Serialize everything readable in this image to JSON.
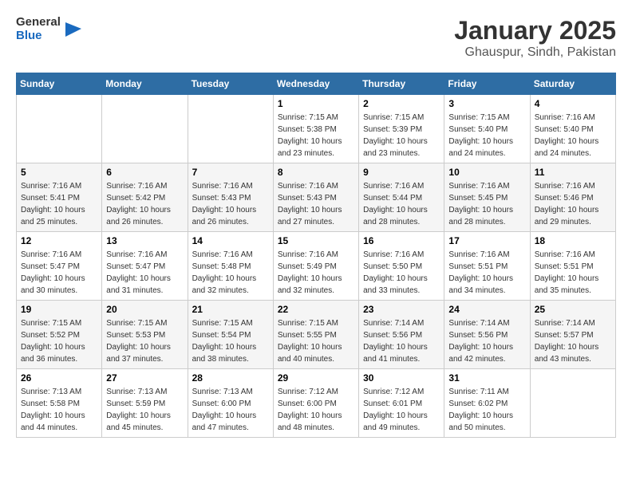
{
  "header": {
    "logo_general": "General",
    "logo_blue": "Blue",
    "month": "January 2025",
    "location": "Ghauspur, Sindh, Pakistan"
  },
  "weekdays": [
    "Sunday",
    "Monday",
    "Tuesday",
    "Wednesday",
    "Thursday",
    "Friday",
    "Saturday"
  ],
  "weeks": [
    [
      {
        "day": "",
        "sunrise": "",
        "sunset": "",
        "daylight": ""
      },
      {
        "day": "",
        "sunrise": "",
        "sunset": "",
        "daylight": ""
      },
      {
        "day": "",
        "sunrise": "",
        "sunset": "",
        "daylight": ""
      },
      {
        "day": "1",
        "sunrise": "7:15 AM",
        "sunset": "5:38 PM",
        "daylight": "10 hours and 23 minutes."
      },
      {
        "day": "2",
        "sunrise": "7:15 AM",
        "sunset": "5:39 PM",
        "daylight": "10 hours and 23 minutes."
      },
      {
        "day": "3",
        "sunrise": "7:15 AM",
        "sunset": "5:40 PM",
        "daylight": "10 hours and 24 minutes."
      },
      {
        "day": "4",
        "sunrise": "7:16 AM",
        "sunset": "5:40 PM",
        "daylight": "10 hours and 24 minutes."
      }
    ],
    [
      {
        "day": "5",
        "sunrise": "7:16 AM",
        "sunset": "5:41 PM",
        "daylight": "10 hours and 25 minutes."
      },
      {
        "day": "6",
        "sunrise": "7:16 AM",
        "sunset": "5:42 PM",
        "daylight": "10 hours and 26 minutes."
      },
      {
        "day": "7",
        "sunrise": "7:16 AM",
        "sunset": "5:43 PM",
        "daylight": "10 hours and 26 minutes."
      },
      {
        "day": "8",
        "sunrise": "7:16 AM",
        "sunset": "5:43 PM",
        "daylight": "10 hours and 27 minutes."
      },
      {
        "day": "9",
        "sunrise": "7:16 AM",
        "sunset": "5:44 PM",
        "daylight": "10 hours and 28 minutes."
      },
      {
        "day": "10",
        "sunrise": "7:16 AM",
        "sunset": "5:45 PM",
        "daylight": "10 hours and 28 minutes."
      },
      {
        "day": "11",
        "sunrise": "7:16 AM",
        "sunset": "5:46 PM",
        "daylight": "10 hours and 29 minutes."
      }
    ],
    [
      {
        "day": "12",
        "sunrise": "7:16 AM",
        "sunset": "5:47 PM",
        "daylight": "10 hours and 30 minutes."
      },
      {
        "day": "13",
        "sunrise": "7:16 AM",
        "sunset": "5:47 PM",
        "daylight": "10 hours and 31 minutes."
      },
      {
        "day": "14",
        "sunrise": "7:16 AM",
        "sunset": "5:48 PM",
        "daylight": "10 hours and 32 minutes."
      },
      {
        "day": "15",
        "sunrise": "7:16 AM",
        "sunset": "5:49 PM",
        "daylight": "10 hours and 32 minutes."
      },
      {
        "day": "16",
        "sunrise": "7:16 AM",
        "sunset": "5:50 PM",
        "daylight": "10 hours and 33 minutes."
      },
      {
        "day": "17",
        "sunrise": "7:16 AM",
        "sunset": "5:51 PM",
        "daylight": "10 hours and 34 minutes."
      },
      {
        "day": "18",
        "sunrise": "7:16 AM",
        "sunset": "5:51 PM",
        "daylight": "10 hours and 35 minutes."
      }
    ],
    [
      {
        "day": "19",
        "sunrise": "7:15 AM",
        "sunset": "5:52 PM",
        "daylight": "10 hours and 36 minutes."
      },
      {
        "day": "20",
        "sunrise": "7:15 AM",
        "sunset": "5:53 PM",
        "daylight": "10 hours and 37 minutes."
      },
      {
        "day": "21",
        "sunrise": "7:15 AM",
        "sunset": "5:54 PM",
        "daylight": "10 hours and 38 minutes."
      },
      {
        "day": "22",
        "sunrise": "7:15 AM",
        "sunset": "5:55 PM",
        "daylight": "10 hours and 40 minutes."
      },
      {
        "day": "23",
        "sunrise": "7:14 AM",
        "sunset": "5:56 PM",
        "daylight": "10 hours and 41 minutes."
      },
      {
        "day": "24",
        "sunrise": "7:14 AM",
        "sunset": "5:56 PM",
        "daylight": "10 hours and 42 minutes."
      },
      {
        "day": "25",
        "sunrise": "7:14 AM",
        "sunset": "5:57 PM",
        "daylight": "10 hours and 43 minutes."
      }
    ],
    [
      {
        "day": "26",
        "sunrise": "7:13 AM",
        "sunset": "5:58 PM",
        "daylight": "10 hours and 44 minutes."
      },
      {
        "day": "27",
        "sunrise": "7:13 AM",
        "sunset": "5:59 PM",
        "daylight": "10 hours and 45 minutes."
      },
      {
        "day": "28",
        "sunrise": "7:13 AM",
        "sunset": "6:00 PM",
        "daylight": "10 hours and 47 minutes."
      },
      {
        "day": "29",
        "sunrise": "7:12 AM",
        "sunset": "6:00 PM",
        "daylight": "10 hours and 48 minutes."
      },
      {
        "day": "30",
        "sunrise": "7:12 AM",
        "sunset": "6:01 PM",
        "daylight": "10 hours and 49 minutes."
      },
      {
        "day": "31",
        "sunrise": "7:11 AM",
        "sunset": "6:02 PM",
        "daylight": "10 hours and 50 minutes."
      },
      {
        "day": "",
        "sunrise": "",
        "sunset": "",
        "daylight": ""
      }
    ]
  ],
  "labels": {
    "sunrise": "Sunrise:",
    "sunset": "Sunset:",
    "daylight": "Daylight:"
  }
}
